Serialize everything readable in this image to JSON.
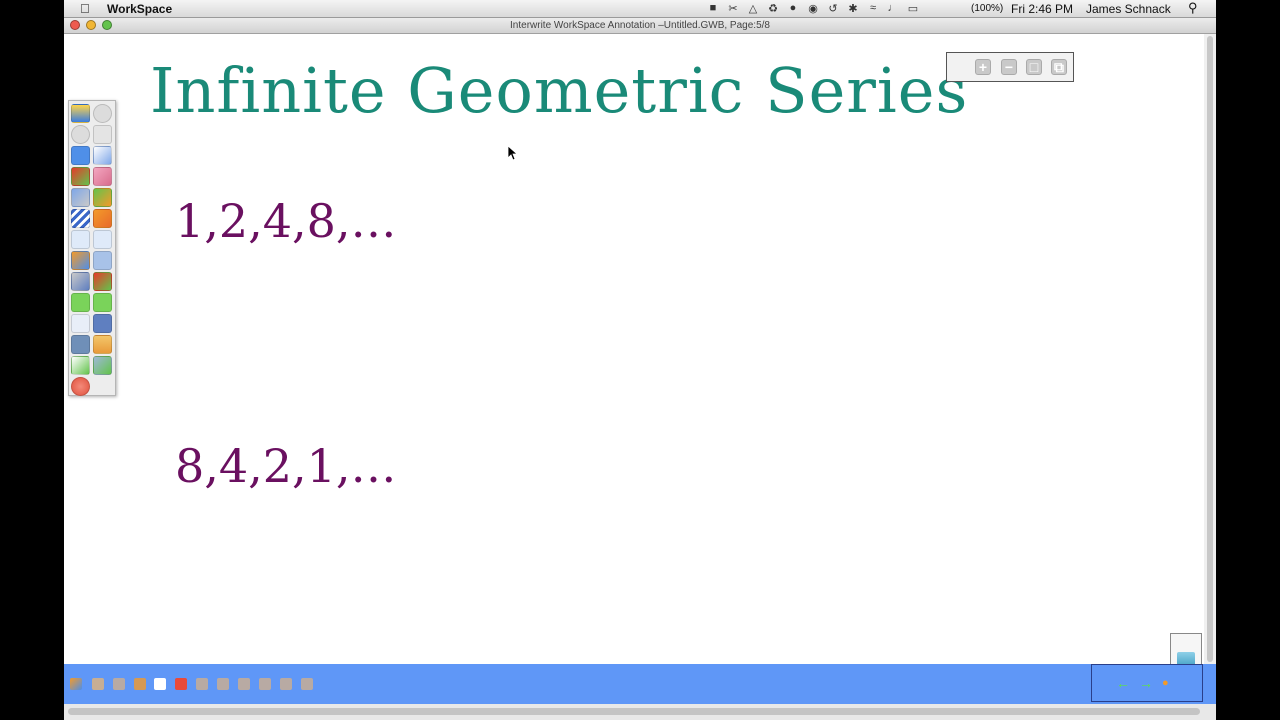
{
  "menubar": {
    "app_name": "WorkSpace",
    "battery": "(100%)",
    "clock": "Fri 2:46 PM",
    "user": "James Schnack",
    "tray_icons": [
      "dropbox-icon",
      "scissors-icon",
      "google-drive-icon",
      "sync-icon",
      "lock-icon",
      "eye-icon",
      "time-machine-icon",
      "bluetooth-icon",
      "wifi-icon",
      "volume-icon",
      "battery-icon"
    ]
  },
  "window": {
    "title": "Interwrite WorkSpace Annotation –Untitled.GWB, Page:5/8"
  },
  "canvas": {
    "heading": "Infinite Geometric Series",
    "sequence_1": "1,2,4,8,…",
    "sequence_2": "8,4,2,1,…"
  },
  "zoom_toolbar": {
    "zoom_in": "+",
    "zoom_out": "−"
  },
  "colors": {
    "heading": "#1a8a78",
    "sequence": "#6a1060",
    "bottom_bar": "#5f97f7"
  }
}
